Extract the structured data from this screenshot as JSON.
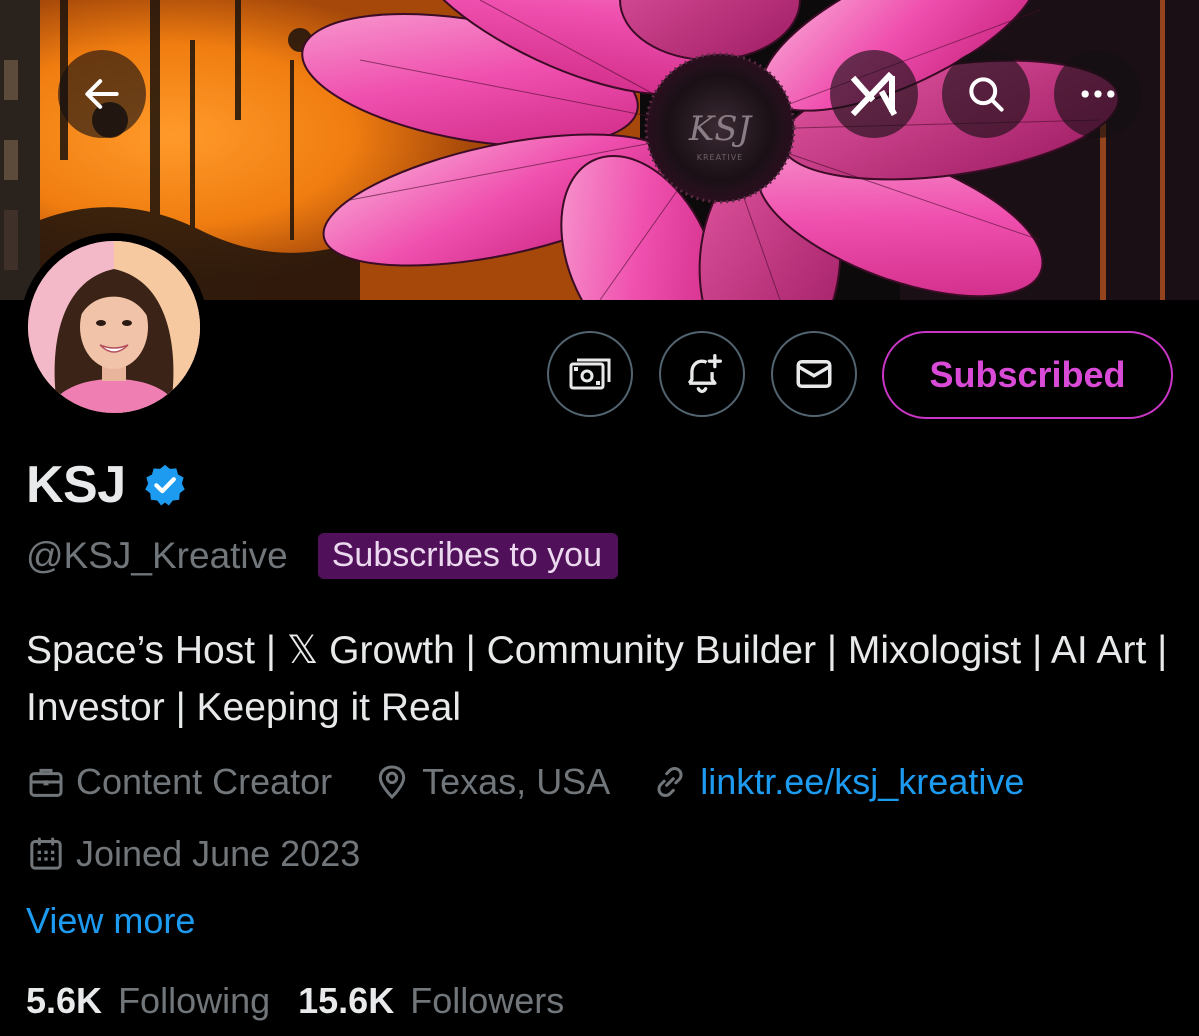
{
  "banner": {
    "logo_text": "KSJ",
    "logo_subtext": "KREATIVE"
  },
  "top_bar": {
    "back_icon": "arrow-left-icon",
    "grok_icon": "grok-logo-icon",
    "search_icon": "search-icon",
    "more_icon": "more-horizontal-icon"
  },
  "actions": {
    "tip_icon": "money-icon",
    "notify_icon": "bell-plus-icon",
    "message_icon": "envelope-icon",
    "subscribed_label": "Subscribed"
  },
  "profile": {
    "display_name": "KSJ",
    "verified": true,
    "handle": "@KSJ_Kreative",
    "subscribes_badge": "Subscribes to you",
    "bio": "Space’s Host | 𝕏 Growth | Community Builder | Mixologist | AI Art | Investor | Keeping it Real",
    "profession": "Content Creator",
    "location": "Texas, USA",
    "website": "linktr.ee/ksj_kreative",
    "joined": "Joined June 2023",
    "view_more": "View more"
  },
  "stats": {
    "following_count": "5.6K",
    "following_label": "Following",
    "followers_count": "15.6K",
    "followers_label": "Followers"
  },
  "colors": {
    "background": "#000000",
    "subscribed_accent": "#c936c6",
    "link_blue": "#1d9bf0",
    "muted_text": "#71767b",
    "badge_bg": "#51115a",
    "verified_blue": "#1d9bf0"
  }
}
